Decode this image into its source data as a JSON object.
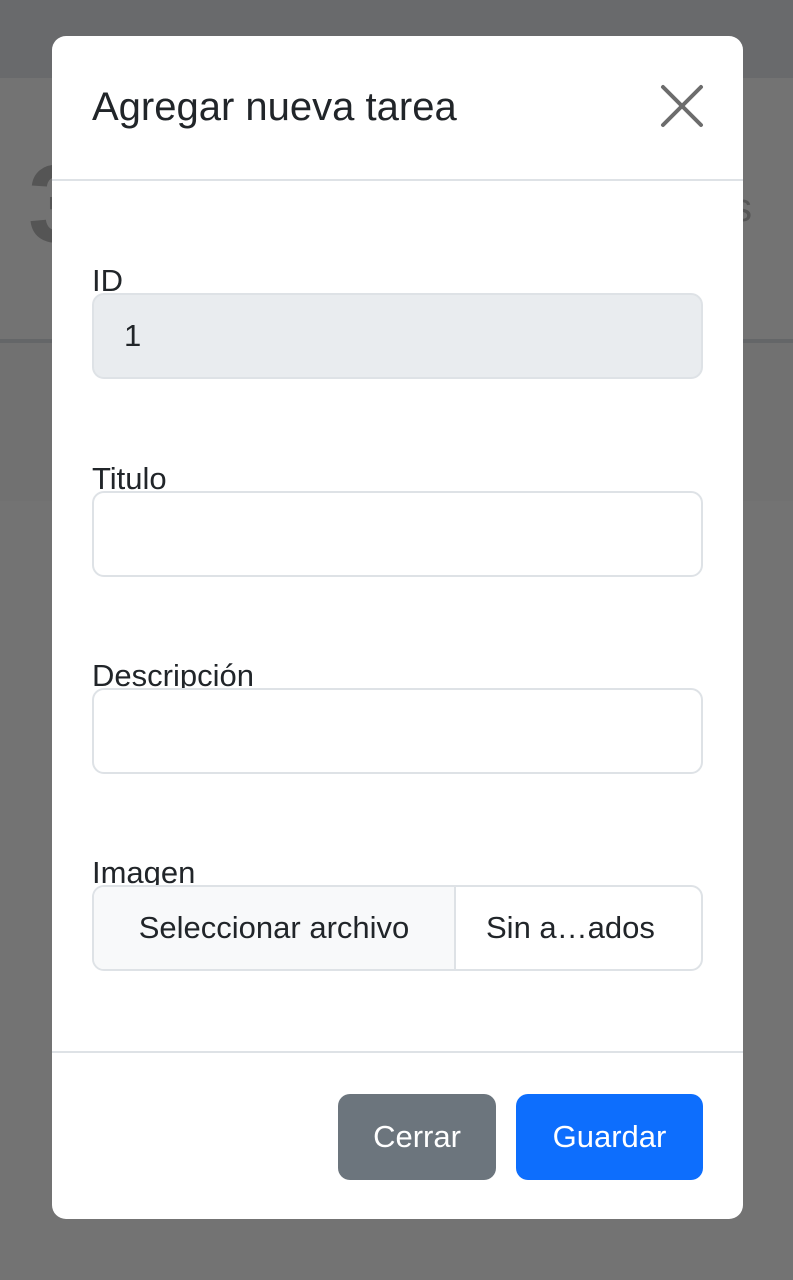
{
  "background": {
    "big_number": "3",
    "right_letter": "s"
  },
  "modal": {
    "title": "Agregar nueva tarea",
    "close_icon": "close-icon",
    "fields": {
      "id": {
        "label": "ID",
        "value": "1"
      },
      "titulo": {
        "label": "Titulo",
        "value": ""
      },
      "descripcion": {
        "label": "Descripción",
        "value": ""
      },
      "imagen": {
        "label": "Imagen",
        "button_label": "Seleccionar archivo",
        "file_status": "Sin a…ados"
      }
    },
    "footer": {
      "close_label": "Cerrar",
      "save_label": "Guardar"
    }
  },
  "colors": {
    "primary": "#0d6efd",
    "secondary": "#6c757d",
    "readonly_bg": "#e9ecef",
    "border": "#dee2e6"
  }
}
